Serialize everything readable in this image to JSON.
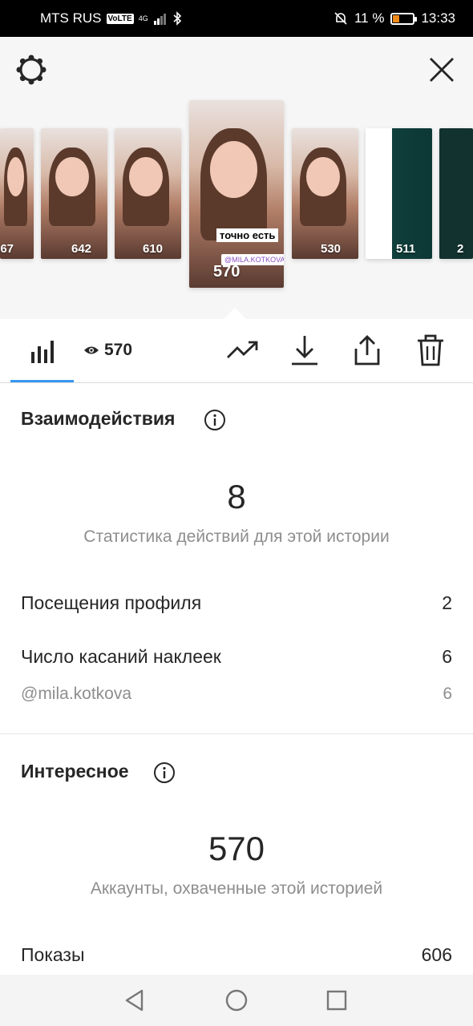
{
  "status_bar": {
    "carrier": "MTS RUS",
    "volte": "VoLTE",
    "network": "4G",
    "battery_percent": "11 %",
    "battery_level": 0.11,
    "time": "13:33",
    "battery_color": "#f08a1a"
  },
  "header": {
    "settings_icon": "gear-icon",
    "close_icon": "close-icon"
  },
  "stories": [
    {
      "views": "567"
    },
    {
      "views": "642"
    },
    {
      "views": "610"
    },
    {
      "views": "570",
      "selected": true,
      "caption": "точно есть",
      "sticker": "@MILA.KOTKOVA"
    },
    {
      "views": "530"
    },
    {
      "views": "511"
    },
    {
      "views": "2"
    }
  ],
  "toolbar": {
    "stats_icon": "bar-chart-icon",
    "eye_icon": "eye-icon",
    "views": "570",
    "promote_icon": "trending-up-icon",
    "download_icon": "download-icon",
    "share_icon": "share-icon",
    "delete_icon": "trash-icon",
    "accent_color": "#3897f0"
  },
  "interactions": {
    "title": "Взаимодействия",
    "total": "8",
    "subtitle": "Статистика действий для этой истории",
    "rows": [
      {
        "label": "Посещения профиля",
        "value": "2"
      },
      {
        "label": "Число касаний наклеек",
        "value": "6"
      }
    ],
    "sub_row": {
      "label": "@mila.kotkova",
      "value": "6"
    }
  },
  "discovery": {
    "title": "Интересное",
    "total": "570",
    "subtitle": "Аккаунты, охваченные этой историей",
    "rows": [
      {
        "label": "Показы",
        "value": "606"
      }
    ]
  },
  "nav": {
    "back_icon": "back-triangle-icon",
    "home_icon": "home-circle-icon",
    "recents_icon": "recents-square-icon"
  }
}
